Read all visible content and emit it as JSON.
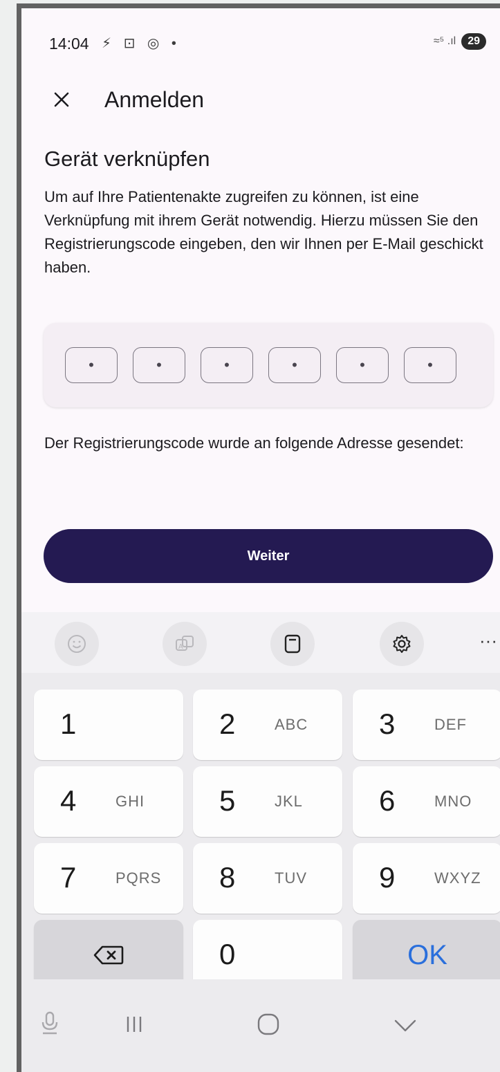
{
  "status_bar": {
    "time": "14:04",
    "left_icons": "⚡ ⊡ ◎ •",
    "signal": "≈⁵ .ıl",
    "battery": "29"
  },
  "app_bar": {
    "title": "Anmelden"
  },
  "content": {
    "heading": "Gerät verknüpfen",
    "description": "Um auf Ihre Patientenakte zugreifen zu können, ist eine Verknüpfung mit ihrem Gerät notwendig. Hierzu müssen Sie den Registrierungscode eingeben, den wir Ihnen per E-Mail geschickt haben.",
    "code_cells": [
      "•",
      "•",
      "•",
      "•",
      "•",
      "•"
    ],
    "sent_text": "Der Registrierungscode wurde an folgende Adresse gesendet:",
    "continue_button": "Weiter"
  },
  "keyboard": {
    "toolbar": [
      "emoji-icon",
      "translate-icon",
      "clipboard-icon",
      "settings-icon",
      "more-icon"
    ],
    "more": "···",
    "keys": [
      {
        "digit": "1",
        "letters": ""
      },
      {
        "digit": "2",
        "letters": "ABC"
      },
      {
        "digit": "3",
        "letters": "DEF"
      },
      {
        "digit": "4",
        "letters": "GHI"
      },
      {
        "digit": "5",
        "letters": "JKL"
      },
      {
        "digit": "6",
        "letters": "MNO"
      },
      {
        "digit": "7",
        "letters": "PQRS"
      },
      {
        "digit": "8",
        "letters": "TUV"
      },
      {
        "digit": "9",
        "letters": "WXYZ"
      },
      {
        "digit": "0",
        "letters": ""
      }
    ],
    "ok_label": "OK"
  },
  "colors": {
    "primary": "#241a52",
    "ok_text": "#2a6fdc"
  }
}
